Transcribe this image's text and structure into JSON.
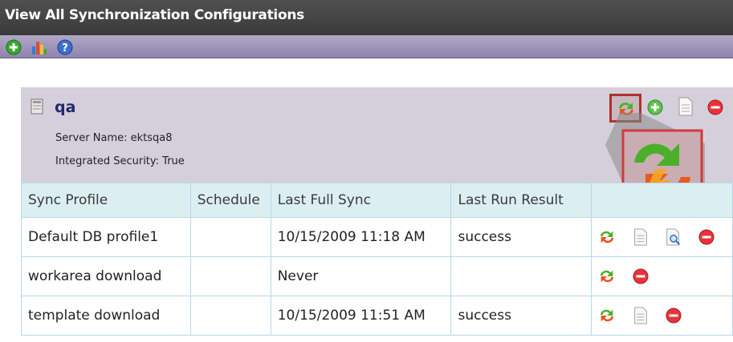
{
  "window": {
    "title": "View All Synchronization Configurations"
  },
  "toolbar": {
    "icons": [
      "add-icon",
      "chart-icon",
      "help-icon"
    ]
  },
  "config": {
    "name": "qa",
    "server_name": "Server Name: ektsqa8",
    "integrated_security": "Integrated Security: True",
    "header_actions": [
      "sync-icon",
      "add-icon",
      "document-icon",
      "delete-icon"
    ]
  },
  "table": {
    "columns": [
      "Sync Profile",
      "Schedule",
      "Last Full Sync",
      "Last Run Result",
      ""
    ],
    "rows": [
      {
        "profile": "Default DB profile1",
        "schedule": "",
        "last_full_sync": "10/15/2009 11:18 AM",
        "result": "success",
        "actions": [
          "sync-icon",
          "document-icon",
          "preview-icon",
          "delete-icon"
        ]
      },
      {
        "profile": "workarea download",
        "schedule": "",
        "last_full_sync": "Never",
        "result": "",
        "actions": [
          "sync-icon",
          "delete-icon"
        ]
      },
      {
        "profile": "template download",
        "schedule": "",
        "last_full_sync": "10/15/2009 11:51 AM",
        "result": "success",
        "actions": [
          "sync-icon",
          "document-icon",
          "delete-icon"
        ]
      }
    ]
  },
  "colors": {
    "title_bar": "#3f3f3f",
    "toolbar": "#9d93b8",
    "card_header": "#d5cfdb",
    "table_header": "#dbeff2",
    "link": "#2d3480",
    "success": "#4d9a1c"
  }
}
